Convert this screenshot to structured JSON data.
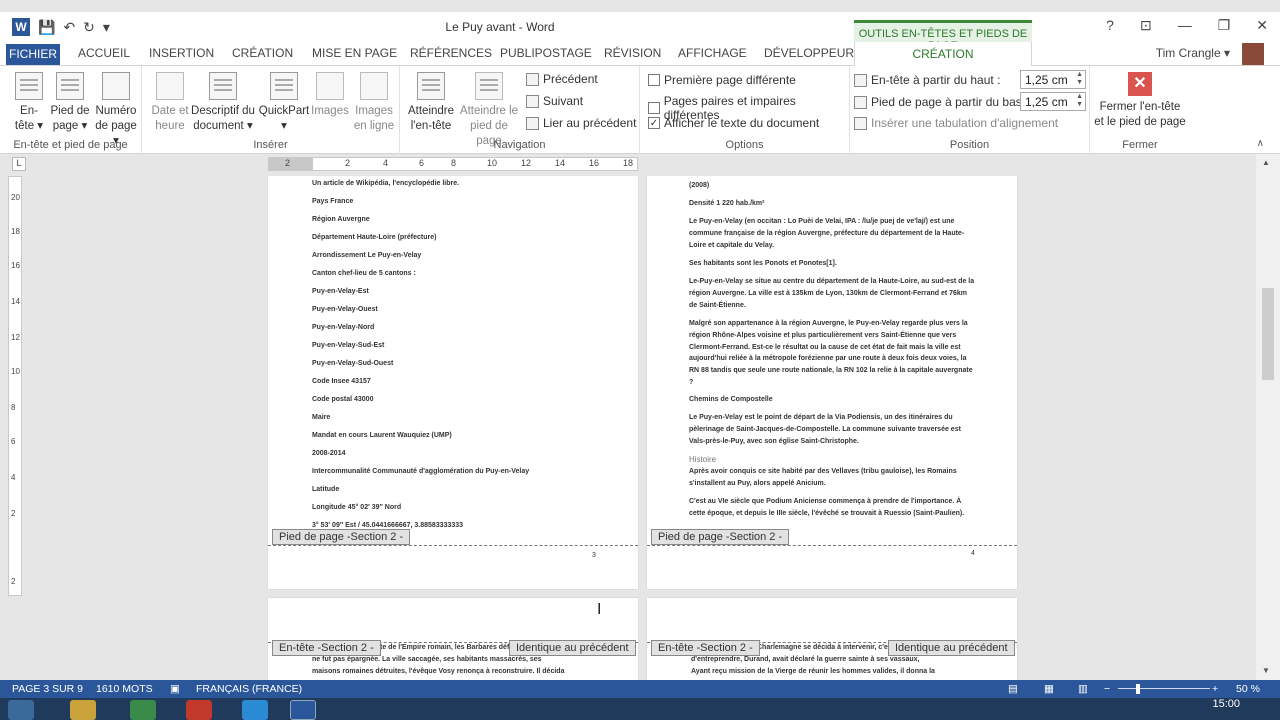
{
  "window": {
    "title": "Le Puy avant - Word",
    "help": "?",
    "controls": [
      "⊡",
      "—",
      "❐",
      "✕"
    ]
  },
  "qat": {
    "logo": "W",
    "save": "💾",
    "undo": "↶",
    "redo": "↻",
    "more": "▾"
  },
  "context_tab_header": "OUTILS EN-TÊTES ET PIEDS DE PAGE",
  "tabs": {
    "fichier": "FICHIER",
    "accueil": "ACCUEIL",
    "insertion": "INSERTION",
    "creation": "CRÉATION",
    "miseenpage": "MISE EN PAGE",
    "references": "RÉFÉRENCES",
    "publipostage": "PUBLIPOSTAGE",
    "revision": "RÉVISION",
    "affichage": "AFFICHAGE",
    "developpeur": "DÉVELOPPEUR",
    "creation_ctx": "CRÉATION"
  },
  "user": {
    "name": "Tim Crangle ▾"
  },
  "ribbon": {
    "group_hf": {
      "label": "En-tête et pied de page",
      "entete": [
        "En-",
        "tête ▾"
      ],
      "pied": [
        "Pied de",
        "page ▾"
      ],
      "numero": [
        "Numéro",
        "de page ▾"
      ]
    },
    "group_inserer": {
      "label": "Insérer",
      "date": [
        "Date et",
        "heure"
      ],
      "descriptif": [
        "Descriptif du",
        "document ▾"
      ],
      "quickpart": [
        "QuickPart",
        "▾"
      ],
      "images": [
        "Images",
        ""
      ],
      "images_ligne": [
        "Images",
        "en ligne"
      ]
    },
    "group_navigation": {
      "label": "Navigation",
      "atteindre_entete": [
        "Atteindre",
        "l'en-tête"
      ],
      "atteindre_pied": [
        "Atteindre le",
        "pied de page"
      ],
      "precedent": "Précédent",
      "suivant": "Suivant",
      "lier": "Lier au précédent"
    },
    "group_options": {
      "label": "Options",
      "premiere": "Première page différente",
      "paires": "Pages paires et impaires différentes",
      "afficher": "Afficher le texte du document",
      "checkmark": "✓"
    },
    "group_position": {
      "label": "Position",
      "entete_haut": "En-tête à partir du haut :",
      "entete_haut_value": "1,25 cm",
      "pied_bas": "Pied de page à partir du bas :",
      "pied_bas_value": "1,25 cm",
      "tabulation": "Insérer une tabulation d'alignement"
    },
    "group_fermer": {
      "label": "Fermer",
      "close": [
        "Fermer l'en-tête",
        "et le pied de page"
      ],
      "close_icon": "✕"
    },
    "collapse": "∧"
  },
  "ruler": {
    "tab_selector": "L",
    "ticks": [
      "2",
      "2",
      "4",
      "6",
      "8",
      "10",
      "12",
      "14",
      "16",
      "18"
    ],
    "vticks": [
      "20",
      "18",
      "16",
      "14",
      "12",
      "10",
      "8",
      "6",
      "4",
      "2",
      "2"
    ]
  },
  "page_left": {
    "lines": [
      "Un article de Wikipédia, l'encyclopédie libre.",
      "Pays  France",
      "Région Auvergne",
      "Département Haute-Loire (préfecture)",
      "Arrondissement Le Puy-en-Velay",
      "Canton chef-lieu de 5 cantons :",
      "Puy-en-Velay-Est",
      "Puy-en-Velay-Ouest",
      "Puy-en-Velay-Nord",
      "Puy-en-Velay-Sud-Est",
      "Puy-en-Velay-Sud-Ouest",
      "Code Insee 43157",
      "Code postal 43000",
      "Maire",
      "Mandat en cours Laurent Wauquiez (UMP)",
      "2008-2014",
      "Intercommunalité Communauté d'agglomération du Puy-en-Velay",
      "Latitude",
      "Longitude 45° 02′ 39″ Nord",
      "3° 53′ 09″ Est / 45.0441666667, 3.88583333333"
    ],
    "footer_tag": "Pied de page -Section 2 -",
    "page_num": "3"
  },
  "page_right": {
    "paras": [
      "(2008)",
      "Densité 1 220 hab./km²",
      "Le Puy-en-Velay (en occitan : Lo Puèi de Velai, IPA : /lu/je puej de ve'laj/) est une commune française de la région Auvergne, préfecture du département de la Haute-Loire et capitale du Velay.",
      "Ses habitants sont les Ponots et Ponotes[1].",
      "Le-Puy-en-Velay se situe au centre du département de la Haute-Loire, au sud-est de la région Auvergne. La ville est à 135km de Lyon, 130km de Clermont-Ferrand et 76km de Saint-Étienne.",
      "Malgré son appartenance à la région Auvergne, le Puy-en-Velay regarde plus vers la région Rhône-Alpes voisine et plus particulièrement vers Saint-Étienne que vers Clermont-Ferrand. Est-ce le résultat ou la cause de cet état de fait mais la ville est aujourd'hui reliée à la métropole forézienne par une route à deux fois deux voies, la RN 88 tandis que seule une route nationale, la RN 102 la relie à la capitale auvergnate ?",
      "Chemins de Compostelle",
      "Le Puy-en-Velay est le point de départ de la Via Podiensis, un des itinéraires du pèlerinage de Saint-Jacques-de-Compostelle. La commune suivante traversée est Vals-près-le-Puy, avec son église Saint-Christophe.",
      "Histoire",
      "Après avoir conquis ce site habité par des Vellaves (tribu gauloise), les Romains s'installent au Puy, alors appelé Anicium.",
      "C'est au VIe siècle que Podium Aniciense commença à prendre de l'importance. À cette époque, et depuis le IIIe siècle, l'évêché se trouvait à Ruessio (Saint-Paulien)."
    ],
    "footer_tag": "Pied de page -Section 2 -",
    "page_num": "4"
  },
  "page_left2": {
    "header_tag": "En-tête -Section 2 -",
    "same_tag": "Identique au précédent",
    "lines": [
      "Après la chute de l'Empire romain, les Barbares déferlèrent sur la région, qui",
      "ne fut pas épargnée. La ville saccagée, ses habitants massacrés, ses",
      "maisons romaines détruites, l'évêque Vosy renonça à reconstruire. Il décida"
    ]
  },
  "page_right2": {
    "header_tag": "En-tête -Section 2 -",
    "same_tag": "Identique au précédent",
    "lines": [
      "Charlemagne se décida à intervenir, c'est qu'avant",
      "d'entreprendre, Durand, avait déclaré la guerre sainte à ses vassaux,",
      "Ayant reçu mission de la Vierge de réunir les hommes valides, il donna la"
    ]
  },
  "status": {
    "page": "PAGE 3 SUR 9",
    "words": "1610 MOTS",
    "lang": "FRANÇAIS (FRANCE)",
    "zoom": "50 %",
    "minus": "−",
    "plus": "+"
  },
  "taskbar": {
    "clock": "15:00"
  },
  "colors": {
    "word_blue": "#2b579a",
    "context_green": "#2b7a2b"
  },
  "icons": {
    "ibeam": "I"
  }
}
